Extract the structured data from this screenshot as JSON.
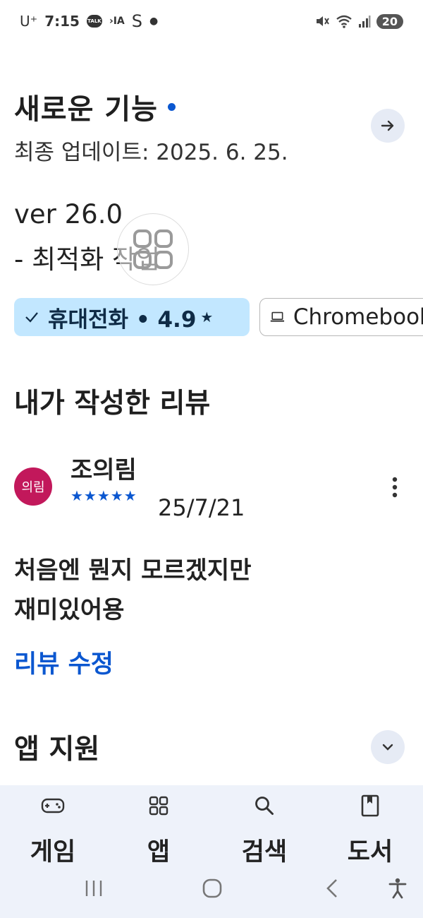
{
  "status_bar": {
    "carrier": "U⁺",
    "time": "7:15",
    "talk_badge": "TALK",
    "battery": "20"
  },
  "whats_new": {
    "title": "새로운 기능",
    "last_updated": "최종 업데이트: 2025. 6. 25.",
    "version_line": "ver 26.0",
    "notes_line": "- 최적화 작업"
  },
  "device_chips": [
    {
      "label": "휴대전화 • 4.9",
      "selected": true,
      "icon": "check-icon",
      "star": "★"
    },
    {
      "label": "Chromebook",
      "selected": false,
      "icon": "laptop-icon"
    }
  ],
  "my_review": {
    "section_title": "내가 작성한 리뷰",
    "avatar_text": "의림",
    "avatar_color": "#c2185b",
    "reviewer_name": "조의림",
    "rating": 5,
    "stars": "★★★★★",
    "date": "25/7/21",
    "text_line1": "처음엔 뭔지 모르겠지만",
    "text_line2": "재미있어용",
    "edit_label": "리뷰 수정"
  },
  "app_support": {
    "title": "앱 지원"
  },
  "bottom_nav": [
    {
      "label": "게임",
      "icon": "gamepad-icon"
    },
    {
      "label": "앱",
      "icon": "apps-grid-icon"
    },
    {
      "label": "검색",
      "icon": "search-icon"
    },
    {
      "label": "도서",
      "icon": "book-icon"
    }
  ],
  "colors": {
    "accent": "#0b57d0",
    "chip_selected_bg": "#c2e7ff",
    "nav_bg": "#eef2fa"
  }
}
